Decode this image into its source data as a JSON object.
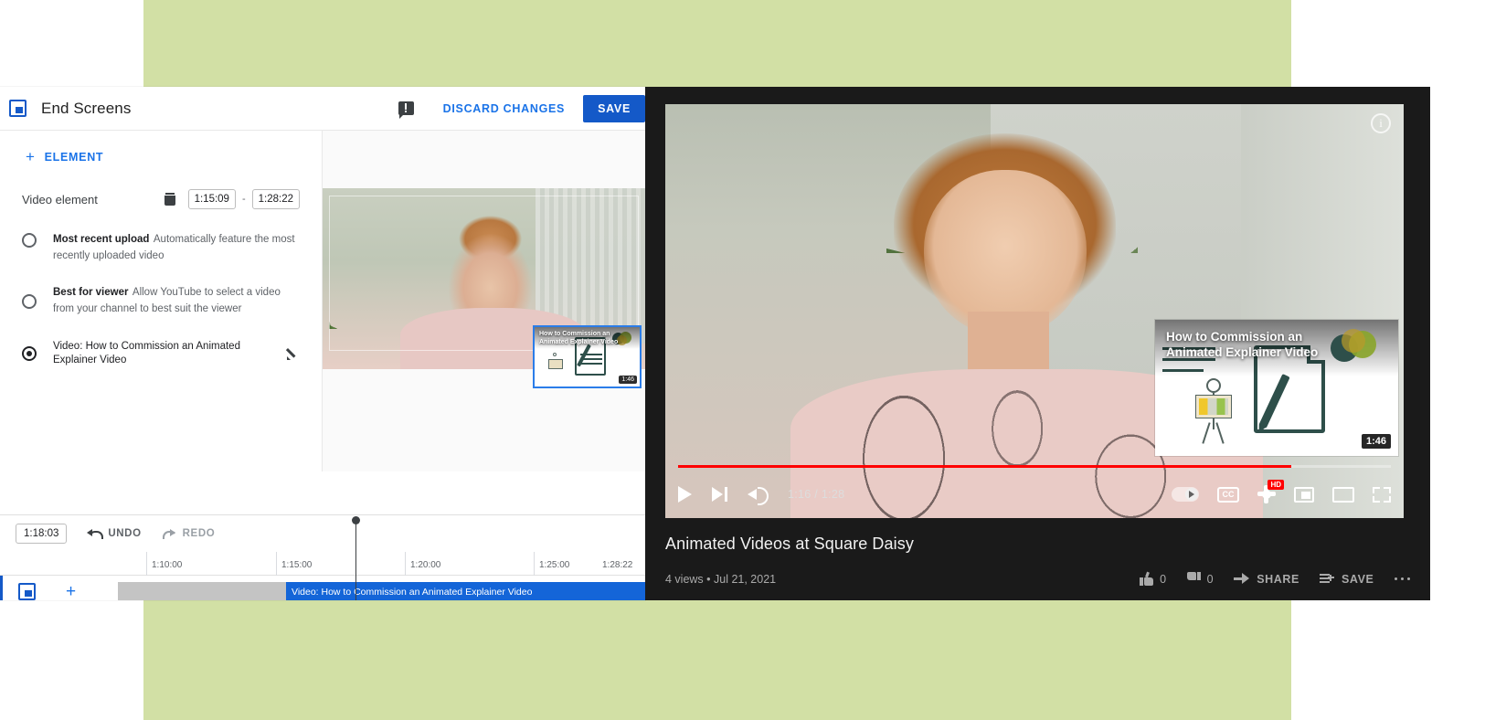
{
  "page": {
    "background_accent": "#d2e0a5"
  },
  "editor": {
    "header": {
      "icon": "end-screens-icon",
      "title": "End Screens",
      "feedback_icon": "feedback-icon",
      "discard_label": "DISCARD CHANGES",
      "save_label": "SAVE",
      "accent_blue": "#1459c8"
    },
    "add_element_label": "ELEMENT",
    "add_element_plus": "+",
    "element": {
      "label": "Video element",
      "delete_icon": "trash-icon",
      "start_time": "1:15:09",
      "separator": "-",
      "end_time": "1:28:22"
    },
    "options": [
      {
        "title": "Most recent upload",
        "desc": "Automatically feature the most recently uploaded video",
        "selected": false
      },
      {
        "title": "Best for viewer",
        "desc": "Allow YouTube to select a video from your channel to best suit the viewer",
        "selected": false
      },
      {
        "title": "Video: How to Commission an Animated Explainer Video",
        "desc": "",
        "selected": true,
        "edit_icon": "pencil-icon"
      }
    ],
    "preview": {
      "card_title": "How to Commission an Animated Explainer Video",
      "card_duration": "1:46"
    },
    "timeline": {
      "current_time": "1:18:03",
      "undo_label": "UNDO",
      "redo_label": "REDO",
      "ruler_ticks": [
        "1:10:00",
        "1:15:00",
        "1:20:00",
        "1:25:00",
        "1:28:22"
      ],
      "endscreen_track_label": "Video: How to Commission an Animated Explainer Video",
      "add_track_plus": "+",
      "video_track_icon": "video-camera-icon",
      "audio_track_icon": "music-note-icon",
      "endscreen_track_icon": "end-screens-icon"
    }
  },
  "youtube": {
    "info_icon": "info-icon",
    "endscreen_card": {
      "title": "How to Commission an Animated Explainer Video",
      "duration": "1:46"
    },
    "controls": {
      "play_icon": "play-icon",
      "next_icon": "next-video-icon",
      "volume_icon": "volume-icon",
      "time": "1:16 / 1:28",
      "autoplay_icon": "autoplay-toggle",
      "captions_label": "CC",
      "settings_icon": "settings-gear-icon",
      "quality_badge": "HD",
      "miniplayer_icon": "miniplayer-icon",
      "theater_icon": "theater-mode-icon",
      "fullscreen_icon": "fullscreen-icon",
      "progress_percent": 86
    },
    "video": {
      "title": "Animated Videos at Square Daisy",
      "views_and_date": "4 views • Jul 21, 2021",
      "like_count": "0",
      "dislike_count": "0",
      "share_label": "SHARE",
      "save_label": "SAVE",
      "more_icon": "more-options-icon"
    }
  }
}
